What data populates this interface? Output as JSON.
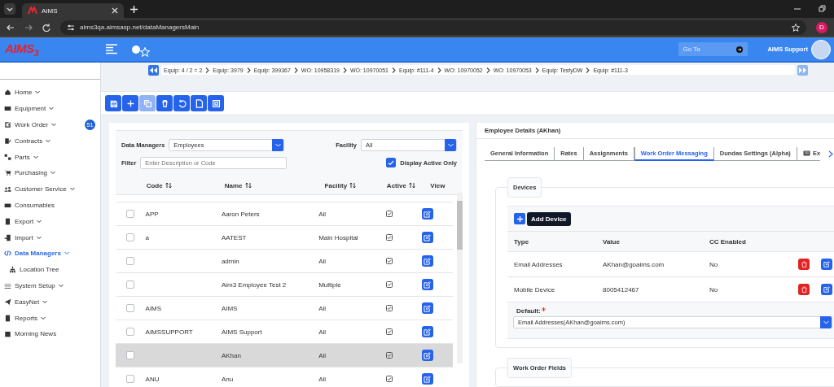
{
  "browser": {
    "tab_title": "AIMS",
    "url": "aims3qa.aimsasp.net/dataManagersMain",
    "profile_initial": "D"
  },
  "header": {
    "logo": "AIMS",
    "logo_suffix": "3",
    "goto": {
      "placeholder": "Go To"
    },
    "user": "AIMS Support"
  },
  "breadcrumbs": [
    "Equip: 4 / 2 = 2",
    "Equip: 3979",
    "Equip: 399367",
    "WO: 10958319",
    "WO: 10970051",
    "Equip: #111-4",
    "WO: 10970052",
    "WO: 10970053",
    "Equip: TestyDW",
    "Equip: #111-3"
  ],
  "sidebar": {
    "items": [
      {
        "kind": "home",
        "label": "Home",
        "expandable": true,
        "selected": false
      },
      {
        "kind": "equipment",
        "label": "Equipment",
        "expandable": true,
        "selected": false
      },
      {
        "kind": "workorder",
        "label": "Work Order",
        "expandable": true,
        "selected": false,
        "badge": "51"
      },
      {
        "kind": "contracts",
        "label": "Contracts",
        "expandable": true,
        "selected": false
      },
      {
        "kind": "parts",
        "label": "Parts",
        "expandable": true,
        "selected": false
      },
      {
        "kind": "purchasing",
        "label": "Purchasing",
        "expandable": true,
        "selected": false
      },
      {
        "kind": "customers",
        "label": "Customer Service",
        "expandable": true,
        "selected": false
      },
      {
        "kind": "consumables",
        "label": "Consumables",
        "expandable": false,
        "selected": false
      },
      {
        "kind": "export",
        "label": "Export",
        "expandable": true,
        "selected": false
      },
      {
        "kind": "import",
        "label": "Import",
        "expandable": true,
        "selected": false
      },
      {
        "kind": "code",
        "label": "Data Managers",
        "expandable": true,
        "selected": true,
        "children": [
          {
            "kind": "tree",
            "label": "Location Tree",
            "expandable": false,
            "selected": false
          }
        ]
      },
      {
        "kind": "setup",
        "label": "System Setup",
        "expandable": true,
        "selected": false
      },
      {
        "kind": "send",
        "label": "EasyNet",
        "expandable": true,
        "selected": false
      },
      {
        "kind": "reports",
        "label": "Reports",
        "expandable": true,
        "selected": false
      },
      {
        "kind": "calendar",
        "label": "Morning News",
        "expandable": false,
        "selected": false
      }
    ]
  },
  "toolbar": [
    {
      "kind": "save",
      "disabled": false
    },
    {
      "kind": "add",
      "disabled": false
    },
    {
      "kind": "copy",
      "disabled": true
    },
    {
      "kind": "delete",
      "disabled": false
    },
    {
      "kind": "undo",
      "disabled": false
    },
    {
      "kind": "document",
      "disabled": false
    },
    {
      "kind": "image",
      "disabled": false
    }
  ],
  "list_panel": {
    "data_managers": {
      "label": "Data Managers",
      "value": "Employees"
    },
    "facility": {
      "label": "Facility",
      "value": "All"
    },
    "filter": {
      "label": "Filter",
      "placeholder": "Enter Description or Code"
    },
    "display_active_only": {
      "label": "Display Active Only",
      "checked": true
    },
    "columns": [
      "Code",
      "Name",
      "Facility",
      "Active",
      "View"
    ],
    "rows": [
      {
        "code": "APP",
        "name": "Aaron Peters",
        "facility": "All",
        "active": true,
        "checked": false,
        "selected": false
      },
      {
        "code": "a",
        "name": "AATEST",
        "facility": "Main Hospital",
        "active": true,
        "checked": false,
        "selected": false
      },
      {
        "code": "",
        "name": "admin",
        "facility": "All",
        "active": true,
        "checked": false,
        "selected": false
      },
      {
        "code": "",
        "name": "Aim3 Employee Test 2",
        "facility": "Multiple",
        "active": true,
        "checked": false,
        "selected": false
      },
      {
        "code": "AIMS",
        "name": "AIMS",
        "facility": "All",
        "active": true,
        "checked": false,
        "selected": false
      },
      {
        "code": "AIMSSUPPORT",
        "name": "AIMS Support",
        "facility": "All",
        "active": true,
        "checked": false,
        "selected": false
      },
      {
        "code": "",
        "name": "AKhan",
        "facility": "All",
        "active": true,
        "checked": false,
        "selected": true
      },
      {
        "code": "ANU",
        "name": "Anu",
        "facility": "All",
        "active": true,
        "checked": false,
        "selected": false
      }
    ]
  },
  "details": {
    "title": "Employee Details (AKhan)",
    "tabs": [
      {
        "label": "General Information",
        "selected": false
      },
      {
        "label": "Rates",
        "selected": false
      },
      {
        "label": "Assignments",
        "selected": false
      },
      {
        "label": "Work Order Messaging",
        "selected": true
      },
      {
        "label": "Dundas Settings (Alpha)",
        "selected": false
      },
      {
        "label": "Ex",
        "selected": false,
        "icon": true
      }
    ],
    "devices": {
      "legend": "Devices",
      "add_label": "Add Device",
      "columns": [
        "Type",
        "Value",
        "CC Enabled"
      ],
      "rows": [
        {
          "type": "Email Addresses",
          "value": "AKhan@goaims.com",
          "cc": "No"
        },
        {
          "type": "Mobile Device",
          "value": "8005412467",
          "cc": "No"
        }
      ],
      "default": {
        "label": "Default:",
        "required": true,
        "value": "Email Addresses(AKhan@goaims.com)"
      }
    },
    "next_legend": "Work Order Fields"
  }
}
